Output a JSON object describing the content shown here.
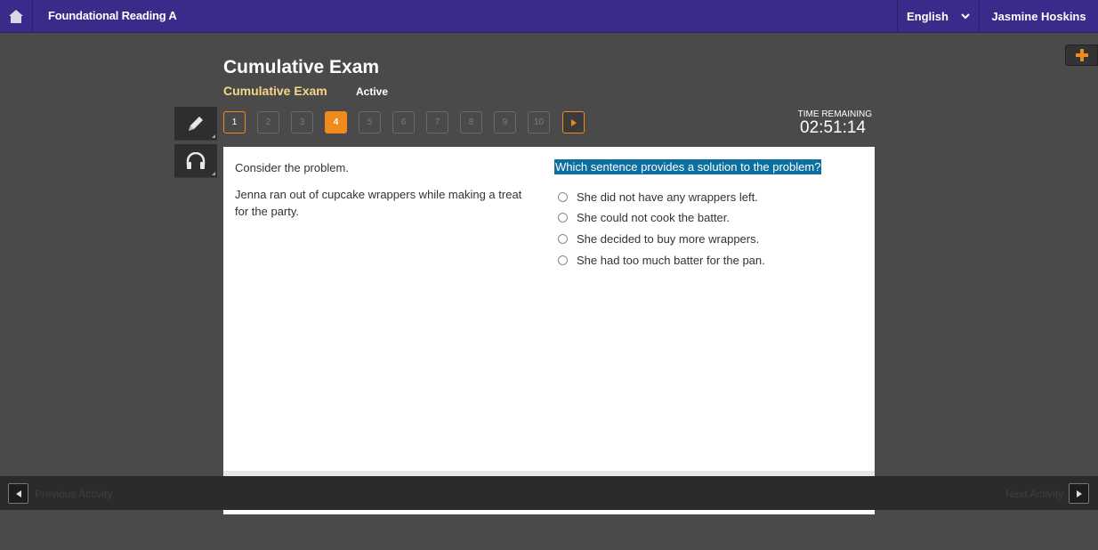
{
  "topbar": {
    "app_title": "Foundational Reading A",
    "language": "English",
    "user_name": "Jasmine Hoskins",
    "bg_color": "#3c2a8a"
  },
  "exam": {
    "title": "Cumulative Exam",
    "subtitle": "Cumulative Exam",
    "status": "Active"
  },
  "tools": [
    {
      "name": "pencil-icon"
    },
    {
      "name": "headphones-icon"
    }
  ],
  "question_nav": {
    "items": [
      {
        "label": "1",
        "state": "visited"
      },
      {
        "label": "2",
        "state": "unvisited"
      },
      {
        "label": "3",
        "state": "unvisited"
      },
      {
        "label": "4",
        "state": "current"
      },
      {
        "label": "5",
        "state": "unvisited"
      },
      {
        "label": "6",
        "state": "unvisited"
      },
      {
        "label": "7",
        "state": "unvisited"
      },
      {
        "label": "8",
        "state": "unvisited"
      },
      {
        "label": "9",
        "state": "unvisited"
      },
      {
        "label": "10",
        "state": "unvisited"
      }
    ],
    "accent_color": "#f08a1c"
  },
  "timer": {
    "label": "TIME REMAINING",
    "value": "02:51:14"
  },
  "passage": {
    "intro": "Consider the problem.",
    "body": "Jenna ran out of cupcake wrappers while making a treat for the party."
  },
  "question": {
    "prompt": "Which sentence provides a solution to the problem?",
    "options": [
      "She did not have any wrappers left.",
      "She could not cook the batter.",
      "She decided to buy more wrappers.",
      "She had too much batter for the pan."
    ]
  },
  "footer": {
    "prev_label": "Previous Activity",
    "next_label": "Next Activity"
  }
}
